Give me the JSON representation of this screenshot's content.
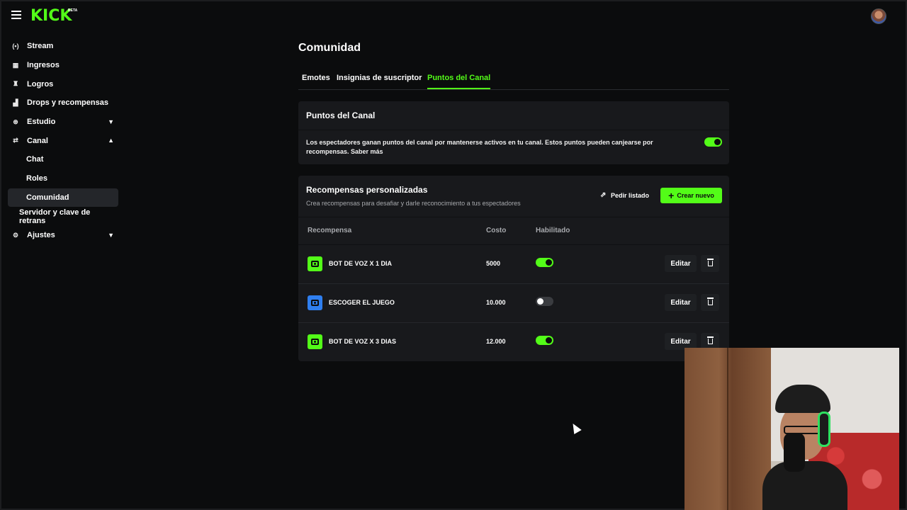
{
  "app": {
    "logo": "KICK",
    "logo_badge": "BETA"
  },
  "sidebar": {
    "items": [
      {
        "label": "Stream",
        "icon": "broadcast-icon",
        "glyph": "((•))"
      },
      {
        "label": "Ingresos",
        "icon": "chart-icon",
        "glyph": "▦"
      },
      {
        "label": "Logros",
        "icon": "trophy-icon",
        "glyph": "🏆"
      },
      {
        "label": "Drops y recompensas",
        "icon": "gift-icon",
        "glyph": "▟"
      },
      {
        "label": "Estudio",
        "icon": "studio-icon",
        "glyph": "⊛",
        "chevron": "⌄"
      },
      {
        "label": "Canal",
        "icon": "channel-icon",
        "glyph": "⇆",
        "chevron": "⌃"
      },
      {
        "label": "Chat"
      },
      {
        "label": "Roles"
      },
      {
        "label": "Comunidad"
      },
      {
        "label": "Servidor y clave de retrans"
      },
      {
        "label": "Ajustes",
        "icon": "gear-icon",
        "glyph": "⚙",
        "chevron": "⌄"
      }
    ]
  },
  "main": {
    "title": "Comunidad",
    "tabs": [
      {
        "label": "Emotes",
        "active": false
      },
      {
        "label": "Insignias de suscriptor",
        "active": false
      },
      {
        "label": "Puntos del Canal",
        "active": true
      }
    ],
    "channel_points": {
      "title": "Puntos del Canal",
      "description": "Los espectadores ganan puntos del canal por mantenerse activos en tu canal. Estos puntos pueden canjearse por recompensas. Saber más",
      "enabled": true
    },
    "custom_rewards": {
      "title": "Recompensas personalizadas",
      "subtitle": "Crea recompensas para desafiar y darle reconocimiento a tus espectadores",
      "request_list_label": "Pedir listado",
      "create_label": "Crear nuevo",
      "columns": [
        "Recompensa",
        "Costo",
        "Habilitado"
      ],
      "edit_label": "Editar",
      "rows": [
        {
          "name": "BOT DE VOZ X 1 DIA",
          "cost": "5000",
          "enabled": true,
          "icon_color": "#53fc18"
        },
        {
          "name": "ESCOGER EL JUEGO",
          "cost": "10.000",
          "enabled": false,
          "icon_color": "#2f7ff0"
        },
        {
          "name": "BOT DE VOZ X 3 DIAS",
          "cost": "12.000",
          "enabled": true,
          "icon_color": "#53fc18"
        }
      ]
    }
  },
  "colors": {
    "accent": "#53fc18",
    "background": "#0b0c0d",
    "card": "#18191c"
  }
}
